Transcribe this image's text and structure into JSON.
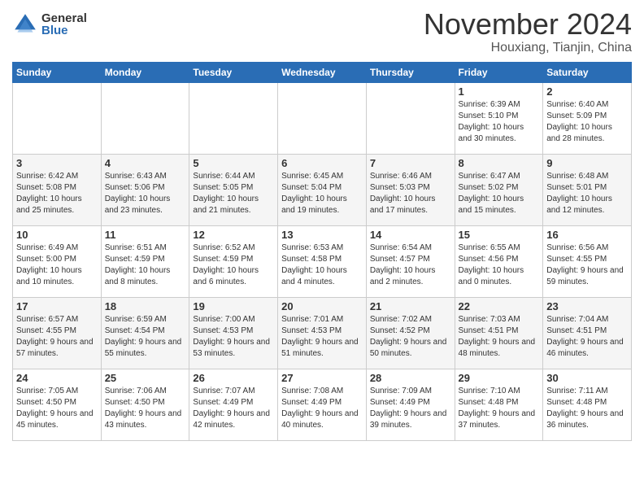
{
  "header": {
    "logo_general": "General",
    "logo_blue": "Blue",
    "month": "November 2024",
    "location": "Houxiang, Tianjin, China"
  },
  "days_of_week": [
    "Sunday",
    "Monday",
    "Tuesday",
    "Wednesday",
    "Thursday",
    "Friday",
    "Saturday"
  ],
  "weeks": [
    [
      {
        "day": "",
        "info": ""
      },
      {
        "day": "",
        "info": ""
      },
      {
        "day": "",
        "info": ""
      },
      {
        "day": "",
        "info": ""
      },
      {
        "day": "",
        "info": ""
      },
      {
        "day": "1",
        "info": "Sunrise: 6:39 AM\nSunset: 5:10 PM\nDaylight: 10 hours and 30 minutes."
      },
      {
        "day": "2",
        "info": "Sunrise: 6:40 AM\nSunset: 5:09 PM\nDaylight: 10 hours and 28 minutes."
      }
    ],
    [
      {
        "day": "3",
        "info": "Sunrise: 6:42 AM\nSunset: 5:08 PM\nDaylight: 10 hours and 25 minutes."
      },
      {
        "day": "4",
        "info": "Sunrise: 6:43 AM\nSunset: 5:06 PM\nDaylight: 10 hours and 23 minutes."
      },
      {
        "day": "5",
        "info": "Sunrise: 6:44 AM\nSunset: 5:05 PM\nDaylight: 10 hours and 21 minutes."
      },
      {
        "day": "6",
        "info": "Sunrise: 6:45 AM\nSunset: 5:04 PM\nDaylight: 10 hours and 19 minutes."
      },
      {
        "day": "7",
        "info": "Sunrise: 6:46 AM\nSunset: 5:03 PM\nDaylight: 10 hours and 17 minutes."
      },
      {
        "day": "8",
        "info": "Sunrise: 6:47 AM\nSunset: 5:02 PM\nDaylight: 10 hours and 15 minutes."
      },
      {
        "day": "9",
        "info": "Sunrise: 6:48 AM\nSunset: 5:01 PM\nDaylight: 10 hours and 12 minutes."
      }
    ],
    [
      {
        "day": "10",
        "info": "Sunrise: 6:49 AM\nSunset: 5:00 PM\nDaylight: 10 hours and 10 minutes."
      },
      {
        "day": "11",
        "info": "Sunrise: 6:51 AM\nSunset: 4:59 PM\nDaylight: 10 hours and 8 minutes."
      },
      {
        "day": "12",
        "info": "Sunrise: 6:52 AM\nSunset: 4:59 PM\nDaylight: 10 hours and 6 minutes."
      },
      {
        "day": "13",
        "info": "Sunrise: 6:53 AM\nSunset: 4:58 PM\nDaylight: 10 hours and 4 minutes."
      },
      {
        "day": "14",
        "info": "Sunrise: 6:54 AM\nSunset: 4:57 PM\nDaylight: 10 hours and 2 minutes."
      },
      {
        "day": "15",
        "info": "Sunrise: 6:55 AM\nSunset: 4:56 PM\nDaylight: 10 hours and 0 minutes."
      },
      {
        "day": "16",
        "info": "Sunrise: 6:56 AM\nSunset: 4:55 PM\nDaylight: 9 hours and 59 minutes."
      }
    ],
    [
      {
        "day": "17",
        "info": "Sunrise: 6:57 AM\nSunset: 4:55 PM\nDaylight: 9 hours and 57 minutes."
      },
      {
        "day": "18",
        "info": "Sunrise: 6:59 AM\nSunset: 4:54 PM\nDaylight: 9 hours and 55 minutes."
      },
      {
        "day": "19",
        "info": "Sunrise: 7:00 AM\nSunset: 4:53 PM\nDaylight: 9 hours and 53 minutes."
      },
      {
        "day": "20",
        "info": "Sunrise: 7:01 AM\nSunset: 4:53 PM\nDaylight: 9 hours and 51 minutes."
      },
      {
        "day": "21",
        "info": "Sunrise: 7:02 AM\nSunset: 4:52 PM\nDaylight: 9 hours and 50 minutes."
      },
      {
        "day": "22",
        "info": "Sunrise: 7:03 AM\nSunset: 4:51 PM\nDaylight: 9 hours and 48 minutes."
      },
      {
        "day": "23",
        "info": "Sunrise: 7:04 AM\nSunset: 4:51 PM\nDaylight: 9 hours and 46 minutes."
      }
    ],
    [
      {
        "day": "24",
        "info": "Sunrise: 7:05 AM\nSunset: 4:50 PM\nDaylight: 9 hours and 45 minutes."
      },
      {
        "day": "25",
        "info": "Sunrise: 7:06 AM\nSunset: 4:50 PM\nDaylight: 9 hours and 43 minutes."
      },
      {
        "day": "26",
        "info": "Sunrise: 7:07 AM\nSunset: 4:49 PM\nDaylight: 9 hours and 42 minutes."
      },
      {
        "day": "27",
        "info": "Sunrise: 7:08 AM\nSunset: 4:49 PM\nDaylight: 9 hours and 40 minutes."
      },
      {
        "day": "28",
        "info": "Sunrise: 7:09 AM\nSunset: 4:49 PM\nDaylight: 9 hours and 39 minutes."
      },
      {
        "day": "29",
        "info": "Sunrise: 7:10 AM\nSunset: 4:48 PM\nDaylight: 9 hours and 37 minutes."
      },
      {
        "day": "30",
        "info": "Sunrise: 7:11 AM\nSunset: 4:48 PM\nDaylight: 9 hours and 36 minutes."
      }
    ]
  ]
}
